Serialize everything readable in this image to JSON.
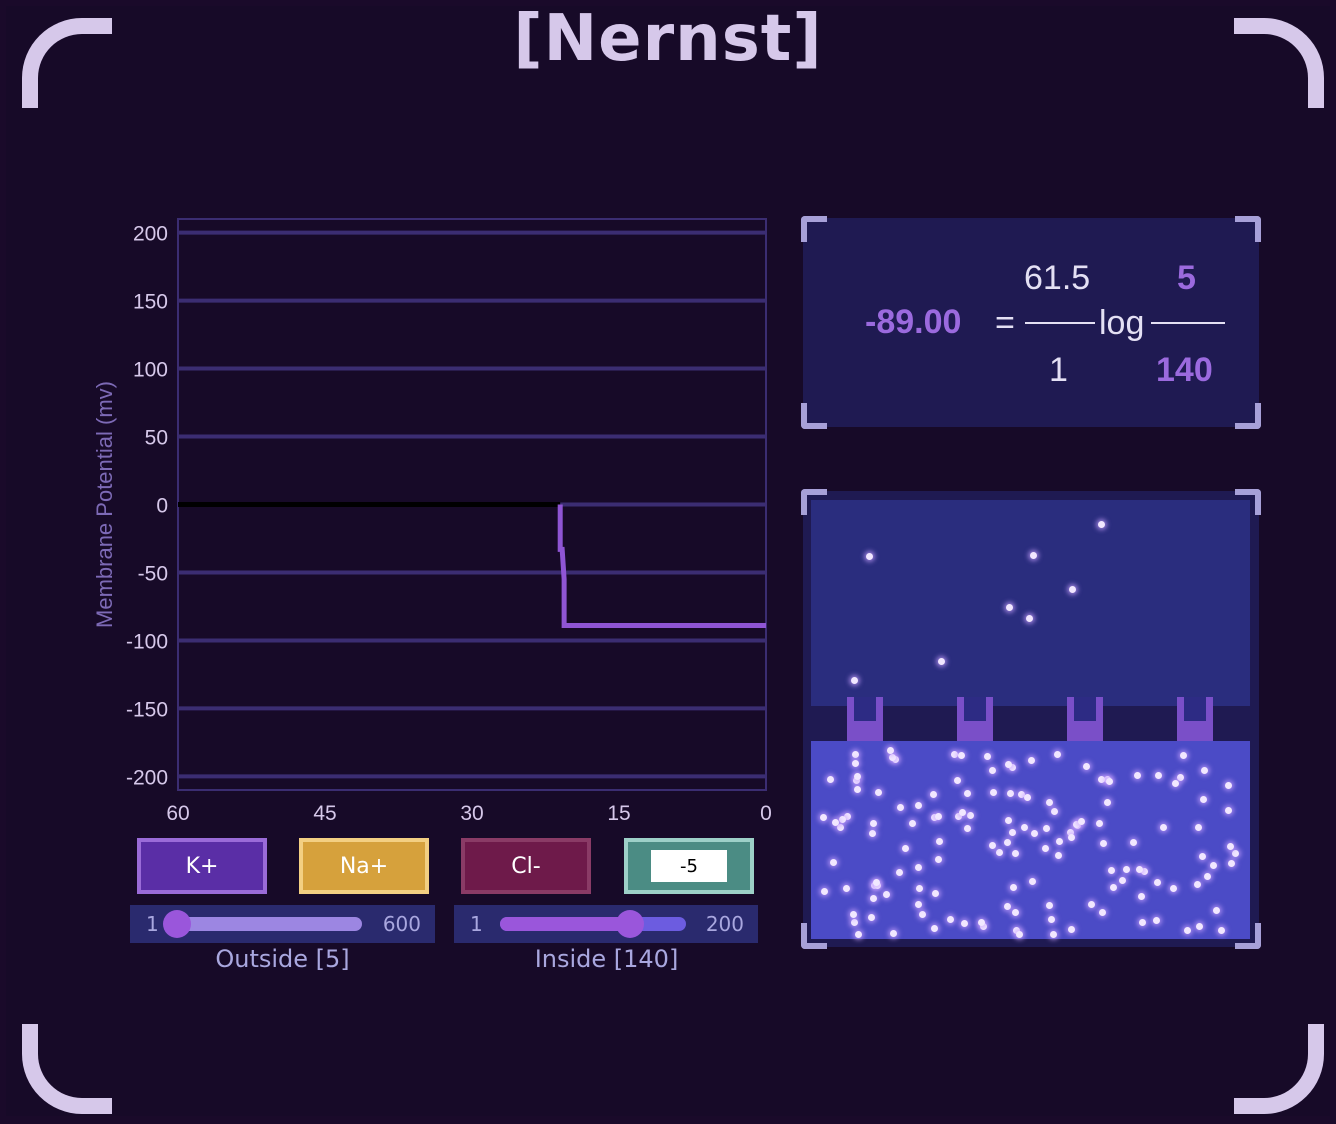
{
  "title": "[Nernst]",
  "chart_data": {
    "type": "line",
    "ylabel": "Membrane Potential (mv)",
    "xlabel": "",
    "xlim": [
      60,
      0
    ],
    "ylim": [
      -210,
      210
    ],
    "x_ticks": [
      60,
      45,
      30,
      15,
      0
    ],
    "y_ticks": [
      200,
      150,
      100,
      50,
      0,
      -50,
      -100,
      -150,
      -200
    ],
    "grid": true,
    "series": [
      {
        "color": "#000000",
        "x": [
          60,
          21
        ],
        "y": [
          0,
          0
        ]
      },
      {
        "color": "#8f55d4",
        "x": [
          21,
          21,
          20.8,
          20.6,
          20.6,
          0
        ],
        "y": [
          0,
          -33,
          -33,
          -55,
          -89,
          -89
        ]
      }
    ]
  },
  "ion_buttons": {
    "k": "K+",
    "na": "Na+",
    "cl": "Cl-"
  },
  "valence_input": "-5",
  "outside_slider": {
    "min": "1",
    "max": "600",
    "value": 5,
    "label": "Outside [5]"
  },
  "inside_slider": {
    "min": "1",
    "max": "200",
    "value": 140,
    "label": "Inside [140]"
  },
  "equation": {
    "result": "-89.00",
    "equals": "=",
    "constant": "61.5",
    "valence": "1",
    "log": "log",
    "outside": "5",
    "inside": "140"
  },
  "colors": {
    "accent": "#9b6ade",
    "potassium": "#5a2ea6",
    "sodium": "#d6a13c",
    "chloride": "#6e1a4a"
  }
}
